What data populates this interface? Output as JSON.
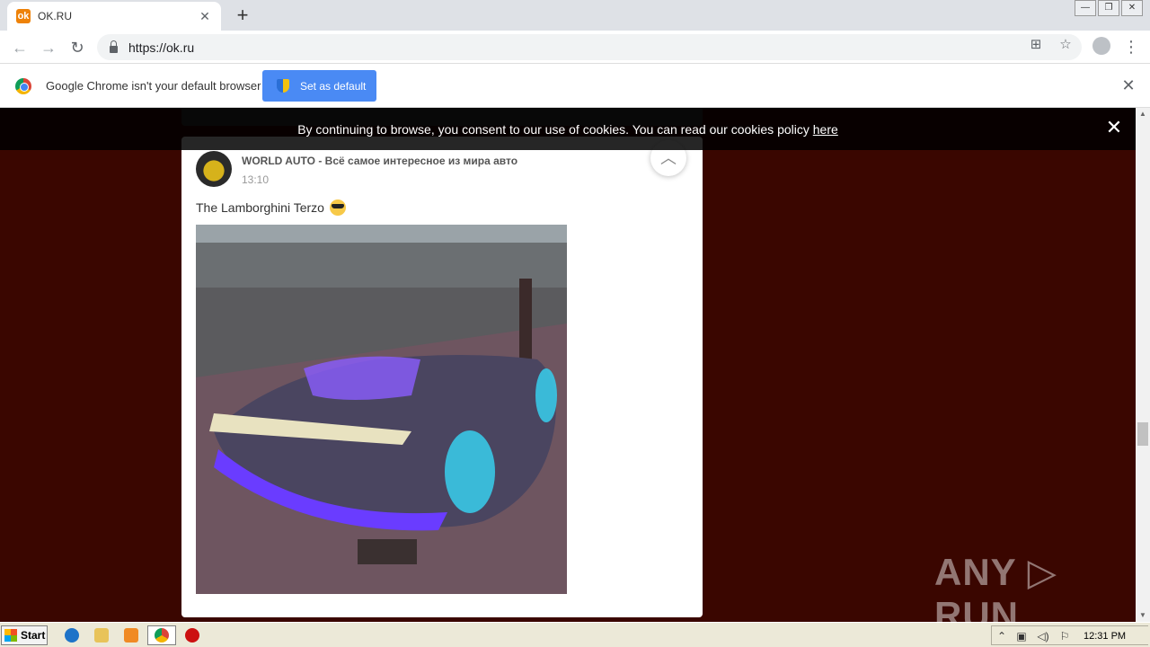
{
  "browser": {
    "tab": {
      "title": "OK.RU",
      "favicon_letter": "ok"
    },
    "new_tab_label": "+",
    "window_controls": [
      "—",
      "❐",
      "✕"
    ],
    "url": "https://ok.ru",
    "infobar": {
      "message": "Google Chrome isn't your default browser",
      "button_label": "Set as default"
    }
  },
  "cookie_notice": {
    "text": "By continuing to browse, you consent to our use of cookies. You can read our cookies policy ",
    "link_text": "here"
  },
  "post": {
    "group_name": "WORLD AUTO - Всё самое интересное из мира авто",
    "time": "13:10",
    "text": "The Lamborghini Terzo"
  },
  "watermark": "ANY ▷ RUN",
  "taskbar": {
    "start_label": "Start",
    "clock": "12:31 PM"
  },
  "colors": {
    "page_background": "#3a0600",
    "accent_button": "#4a8af4",
    "ok_orange": "#ee8208"
  }
}
